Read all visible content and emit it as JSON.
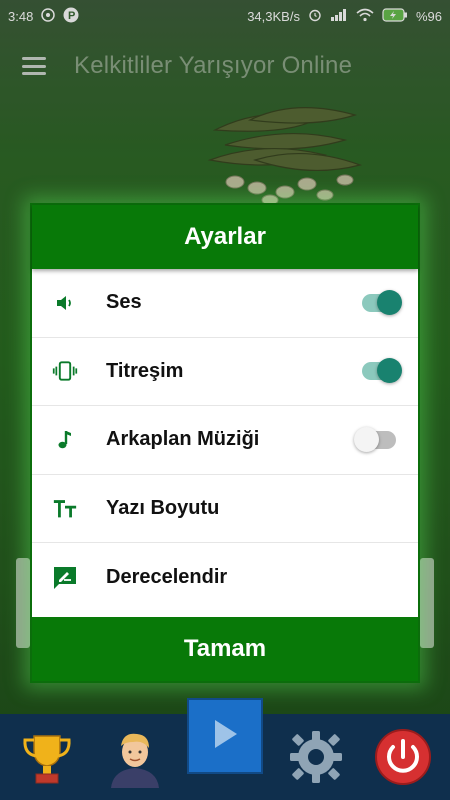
{
  "status_bar": {
    "time": "3:48",
    "speed": "34,3KB/s",
    "battery": "%96"
  },
  "app_bar": {
    "title": "Kelkitliler Yarışıyor Online"
  },
  "dialog": {
    "title": "Ayarlar",
    "items": [
      {
        "label": "Ses",
        "icon": "speaker-icon",
        "toggle": true
      },
      {
        "label": "Titreşim",
        "icon": "vibration-icon",
        "toggle": true
      },
      {
        "label": "Arkaplan Müziği",
        "icon": "music-note-icon",
        "toggle": false
      },
      {
        "label": "Yazı Boyutu",
        "icon": "text-size-icon"
      },
      {
        "label": "Derecelendir",
        "icon": "rate-icon"
      }
    ],
    "ok_label": "Tamam"
  },
  "colors": {
    "primary_green": "#087908",
    "toggle_on": "#19826f",
    "toggle_off": "#bdbdbd",
    "bottom_nav": "#0f2f4d",
    "play_button": "#1b6fc8"
  },
  "bottom_nav": {
    "items": [
      {
        "icon": "trophy-icon"
      },
      {
        "icon": "profile-avatar-icon"
      },
      {
        "icon": "play-icon"
      },
      {
        "icon": "gear-icon"
      },
      {
        "icon": "power-icon"
      }
    ]
  }
}
